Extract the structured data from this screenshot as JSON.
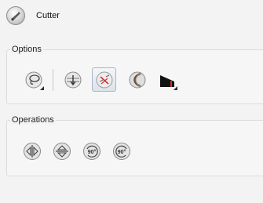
{
  "header": {
    "title": "Cutter",
    "icon": "cutter-tool-icon"
  },
  "options": {
    "label": "Options",
    "buttons": [
      {
        "name": "lasso-select-button",
        "icon": "lasso-icon",
        "active": false,
        "has_menu": true
      },
      {
        "name": "use-mouse-button",
        "icon": "sphere-arrow-icon",
        "active": false,
        "has_menu": false
      },
      {
        "name": "cut-mode-button",
        "icon": "scissors-cross-icon",
        "active": true,
        "has_menu": false
      },
      {
        "name": "tip-style-button",
        "icon": "curve-sphere-icon",
        "active": false,
        "has_menu": false
      },
      {
        "name": "mark-color-button",
        "icon": "wedge-red-icon",
        "active": false,
        "has_menu": true
      }
    ]
  },
  "operations": {
    "label": "Operations",
    "buttons": [
      {
        "name": "flip-horizontal-button",
        "icon": "flip-horizontal-icon"
      },
      {
        "name": "flip-vertical-button",
        "icon": "flip-vertical-icon"
      },
      {
        "name": "rotate-cw-button",
        "icon": "rotate-90-cw-icon",
        "text": "90°"
      },
      {
        "name": "rotate-ccw-button",
        "icon": "rotate-90-ccw-icon",
        "text": "90°"
      }
    ]
  },
  "colors": {
    "background": "#f3f3f3",
    "active_border": "#a9b6c5",
    "accent_red": "#d9302a"
  }
}
